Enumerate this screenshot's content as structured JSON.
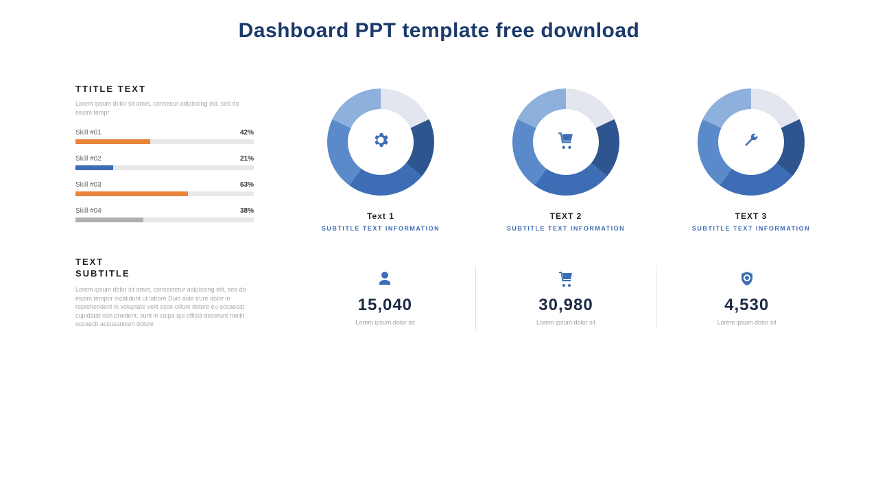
{
  "title": "Dashboard PPT template free download",
  "left": {
    "heading": "TTITLE  TEXT",
    "sub": "Lorem ipsum dolor sit amet, consecur adipiscing elit, sed do eiusm tempr",
    "skills": [
      {
        "label": "Skill #01",
        "pct": 42,
        "pct_label": "42%",
        "color": "#e8833a"
      },
      {
        "label": "Skill #02",
        "pct": 21,
        "pct_label": "21%",
        "color": "#3d6db5"
      },
      {
        "label": "Skill #03",
        "pct": 63,
        "pct_label": "63%",
        "color": "#e8833a"
      },
      {
        "label": "Skill #04",
        "pct": 38,
        "pct_label": "38%",
        "color": "#b0b0b0"
      }
    ],
    "text_subtitle_heading_1": "TEXT",
    "text_subtitle_heading_2": "SUBTITLE",
    "text_subtitle_body": "Lorem ipsum dolor sit amet, consectetur adipiscing elit, sed do eiusm tempor incididunt ut labore Duis aute irure dolor in reprehenderit in voluptate velit esse cillum dolore eu occaecat cupidatat non proident, sunt in culpa qui officia deserunt mollit occaecb accusantium dolore"
  },
  "donuts": [
    {
      "label": "Text 1",
      "sub": "SUBTITLE  TEXT  INFORMATION",
      "icon": "gears"
    },
    {
      "label": "TEXT  2",
      "sub": "SUBTITLE  TEXT  INFORMATION",
      "icon": "cart"
    },
    {
      "label": "TEXT  3",
      "sub": "SUBTITLE  TEXT  INFORMATION",
      "icon": "wrench"
    }
  ],
  "stats": [
    {
      "icon": "user",
      "value": "15,040",
      "caption": "Lorem ipsum dolor sit"
    },
    {
      "icon": "cart",
      "value": "30,980",
      "caption": "Lorem ipsum dolor sit"
    },
    {
      "icon": "shield",
      "value": "4,530",
      "caption": "Lorem ipsum dolor sit"
    }
  ],
  "chart_data": {
    "skills": {
      "type": "bar",
      "categories": [
        "Skill #01",
        "Skill #02",
        "Skill #03",
        "Skill #04"
      ],
      "values": [
        42,
        21,
        63,
        38
      ],
      "unit": "%",
      "title": "TTITLE TEXT",
      "xlim": [
        0,
        100
      ]
    },
    "donuts": [
      {
        "type": "pie",
        "title": "Text 1",
        "series": [
          {
            "name": "seg1",
            "value": 18,
            "color": "#e4e6ef"
          },
          {
            "name": "seg2",
            "value": 18,
            "color": "#2f558f"
          },
          {
            "name": "seg3",
            "value": 24,
            "color": "#3d6db5"
          },
          {
            "name": "seg4",
            "value": 22,
            "color": "#5a8ac9"
          },
          {
            "name": "seg5",
            "value": 18,
            "color": "#8db1dc"
          }
        ],
        "icon": "gears",
        "subtitle": "SUBTITLE TEXT INFORMATION",
        "hole": 0.62
      },
      {
        "type": "pie",
        "title": "TEXT 2",
        "series": [
          {
            "name": "seg1",
            "value": 18,
            "color": "#e4e6ef"
          },
          {
            "name": "seg2",
            "value": 18,
            "color": "#2f558f"
          },
          {
            "name": "seg3",
            "value": 24,
            "color": "#3d6db5"
          },
          {
            "name": "seg4",
            "value": 22,
            "color": "#5a8ac9"
          },
          {
            "name": "seg5",
            "value": 18,
            "color": "#8db1dc"
          }
        ],
        "icon": "cart",
        "subtitle": "SUBTITLE TEXT INFORMATION",
        "hole": 0.62
      },
      {
        "type": "pie",
        "title": "TEXT 3",
        "series": [
          {
            "name": "seg1",
            "value": 18,
            "color": "#e4e6ef"
          },
          {
            "name": "seg2",
            "value": 18,
            "color": "#2f558f"
          },
          {
            "name": "seg3",
            "value": 24,
            "color": "#3d6db5"
          },
          {
            "name": "seg4",
            "value": 22,
            "color": "#5a8ac9"
          },
          {
            "name": "seg5",
            "value": 18,
            "color": "#8db1dc"
          }
        ],
        "icon": "wrench",
        "subtitle": "SUBTITLE TEXT INFORMATION",
        "hole": 0.62
      }
    ]
  }
}
